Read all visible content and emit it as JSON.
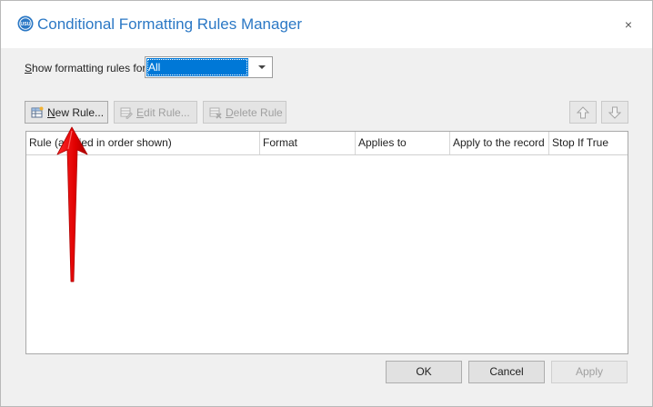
{
  "window": {
    "title": "Conditional Formatting Rules Manager",
    "close_label": "×",
    "accent_color": "#2b78c5"
  },
  "filter": {
    "label_accel": "S",
    "label_rest": "how formatting rules for:",
    "selected_value": "All"
  },
  "toolbar": {
    "new_rule_accel": "N",
    "new_rule_rest": "ew Rule...",
    "edit_rule_accel": "E",
    "edit_rule_rest": "dit Rule...",
    "delete_rule_accel": "D",
    "delete_rule_rest": "elete Rule",
    "move_up_icon": "arrow-up-icon",
    "move_down_icon": "arrow-down-icon"
  },
  "table": {
    "columns": [
      "Rule (applied in order shown)",
      "Format",
      "Applies to",
      "Apply to the record",
      "Stop If True"
    ],
    "rows": []
  },
  "footer": {
    "ok_label": "OK",
    "cancel_label": "Cancel",
    "apply_label": "Apply"
  },
  "annotation": {
    "pointer_icon": "red-arrow-pointer",
    "color": "#e00000"
  }
}
